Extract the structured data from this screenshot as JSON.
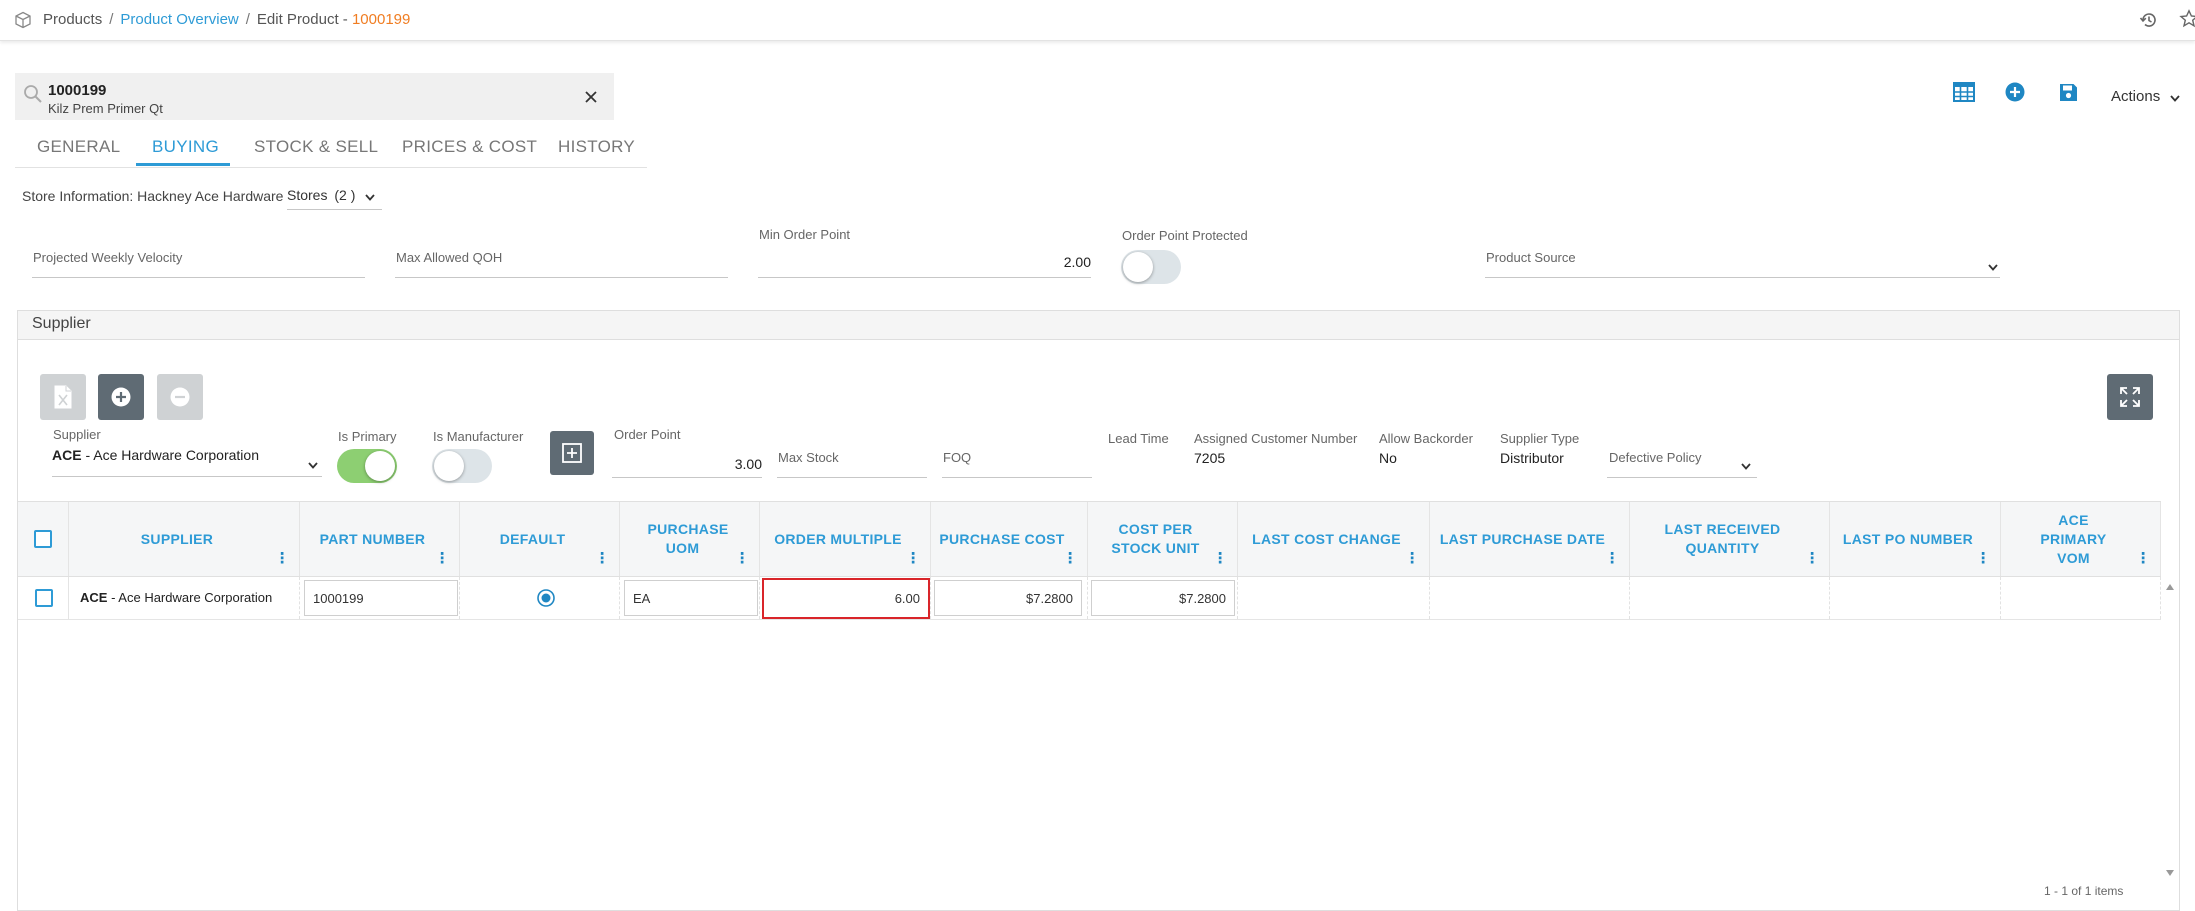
{
  "breadcrumb": {
    "root": "Products",
    "parent": "Product Overview",
    "current_prefix": "Edit Product - ",
    "current_code": "1000199",
    "separator": "/"
  },
  "search": {
    "code": "1000199",
    "name": "Kilz Prem Primer Qt"
  },
  "header_actions": {
    "actions_label": "Actions"
  },
  "tabs": [
    {
      "label": "GENERAL"
    },
    {
      "label": "BUYING"
    },
    {
      "label": "STOCK & SELL"
    },
    {
      "label": "PRICES & COST"
    },
    {
      "label": "HISTORY"
    }
  ],
  "active_tab": "BUYING",
  "store_info": {
    "label": "Store Information: Hackney Ace Hardware",
    "stores_select": "Stores",
    "stores_count": "(2 )"
  },
  "fields": {
    "projected_weekly_velocity": {
      "label": "Projected Weekly Velocity",
      "value": ""
    },
    "max_allowed_qoh": {
      "label": "Max Allowed QOH",
      "value": ""
    },
    "min_order_point": {
      "label": "Min Order Point",
      "value": "2.00"
    },
    "order_point_protected": {
      "label": "Order Point Protected",
      "on": false
    },
    "product_source": {
      "label": "Product Source",
      "value": ""
    }
  },
  "supplier_panel": {
    "title": "Supplier",
    "supplier": {
      "label": "Supplier",
      "code": "ACE",
      "name": "- Ace Hardware Corporation"
    },
    "is_primary": {
      "label": "Is Primary",
      "on": true
    },
    "is_manufacturer": {
      "label": "Is Manufacturer",
      "on": false
    },
    "order_point": {
      "label": "Order Point",
      "value": "3.00"
    },
    "max_stock": {
      "label": "Max Stock",
      "value": ""
    },
    "foq": {
      "label": "FOQ",
      "value": ""
    },
    "lead_time": {
      "label": "Lead Time",
      "value": ""
    },
    "assigned_customer_number": {
      "label": "Assigned Customer Number",
      "value": "7205"
    },
    "allow_backorder": {
      "label": "Allow Backorder",
      "value": "No"
    },
    "supplier_type": {
      "label": "Supplier Type",
      "value": "Distributor"
    },
    "defective_policy": {
      "label": "Defective Policy",
      "value": ""
    }
  },
  "grid": {
    "columns": [
      {
        "key": "supplier",
        "label": "SUPPLIER"
      },
      {
        "key": "part_number",
        "label": "PART NUMBER"
      },
      {
        "key": "default",
        "label": "DEFAULT"
      },
      {
        "key": "purchase_uom",
        "label": "PURCHASE UOM"
      },
      {
        "key": "order_multiple",
        "label": "ORDER MULTIPLE"
      },
      {
        "key": "purchase_cost",
        "label": "PURCHASE COST"
      },
      {
        "key": "cost_per_stock_unit",
        "label": "COST PER STOCK UNIT"
      },
      {
        "key": "last_cost_change",
        "label": "LAST COST CHANGE"
      },
      {
        "key": "last_purchase_date",
        "label": "LAST PURCHASE DATE"
      },
      {
        "key": "last_received_quantity",
        "label": "LAST RECEIVED QUANTITY"
      },
      {
        "key": "last_po_number",
        "label": "LAST PO NUMBER"
      },
      {
        "key": "ace_primary_vom",
        "label": "ACE PRIMARY VOM"
      }
    ],
    "rows": [
      {
        "supplier_code": "ACE",
        "supplier_name": "- Ace Hardware Corporation",
        "part_number": "1000199",
        "default": true,
        "purchase_uom": "EA",
        "order_multiple": "6.00",
        "purchase_cost": "$7.2800",
        "cost_per_stock_unit": "$7.2800",
        "last_cost_change": "",
        "last_purchase_date": "",
        "last_received_quantity": "",
        "last_po_number": "",
        "ace_primary_vom": ""
      }
    ],
    "pager": "1 - 1 of 1 items"
  },
  "colors": {
    "accent": "#2e9bd6",
    "orange": "#f07d22",
    "toggle_on": "#8dcf72",
    "highlight_border": "#d9252a",
    "dark_button": "#5f6b74"
  }
}
